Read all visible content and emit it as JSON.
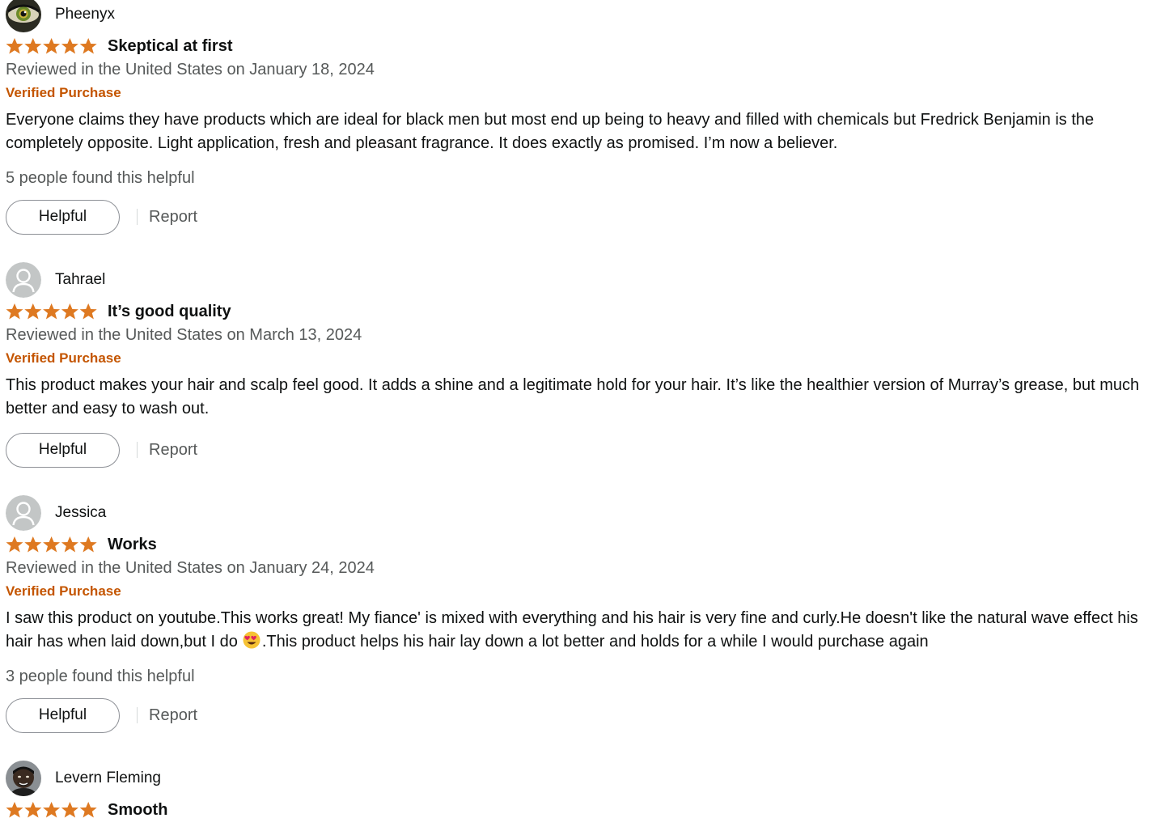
{
  "colors": {
    "star": "#de7921",
    "verified": "#c45500",
    "secondary_text": "#565959",
    "primary_text": "#0f1111"
  },
  "reviews": [
    {
      "name": "Pheenyx",
      "avatar_icon": "eye-avatar-icon",
      "rating": 5,
      "title": "Skeptical at first",
      "date": "Reviewed in the United States on January 18, 2024",
      "verified": "Verified Purchase",
      "body": "Everyone claims they have products which are ideal for black men but most end up being to heavy and filled with chemicals but Fredrick Benjamin is the completely opposite. Light application, fresh and pleasant fragrance. It does exactly as promised. I’m now a believer.",
      "helpful_count": "5 people found this helpful",
      "helpful_label": "Helpful",
      "report_label": "Report"
    },
    {
      "name": "Tahrael",
      "avatar_icon": "default-user-avatar-icon",
      "rating": 5,
      "title": "It’s good quality",
      "date": "Reviewed in the United States on March 13, 2024",
      "verified": "Verified Purchase",
      "body": "This product makes your hair and scalp feel good. It adds a shine and a legitimate hold for your hair. It’s like the healthier version of Murray’s grease, but much better and easy to wash out.",
      "helpful_label": "Helpful",
      "report_label": "Report"
    },
    {
      "name": "Jessica",
      "avatar_icon": "default-user-avatar-icon",
      "rating": 5,
      "title": "Works",
      "date": "Reviewed in the United States on January 24, 2024",
      "verified": "Verified Purchase",
      "body_part1": "I saw this product on youtube.This works great! My fiance' is mixed with everything and his hair is very fine and curly.He doesn't like the natural wave effect his hair has when laid down,but I do",
      "body_emoji": "heart-eyes-emoji-icon",
      "body_part2": ".This product helps his hair lay down a lot better and holds for a while I would purchase again",
      "helpful_count": "3 people found this helpful",
      "helpful_label": "Helpful",
      "report_label": "Report"
    },
    {
      "name": "Levern Fleming",
      "avatar_icon": "man-photo-avatar-icon",
      "rating": 5,
      "title": "Smooth"
    }
  ]
}
